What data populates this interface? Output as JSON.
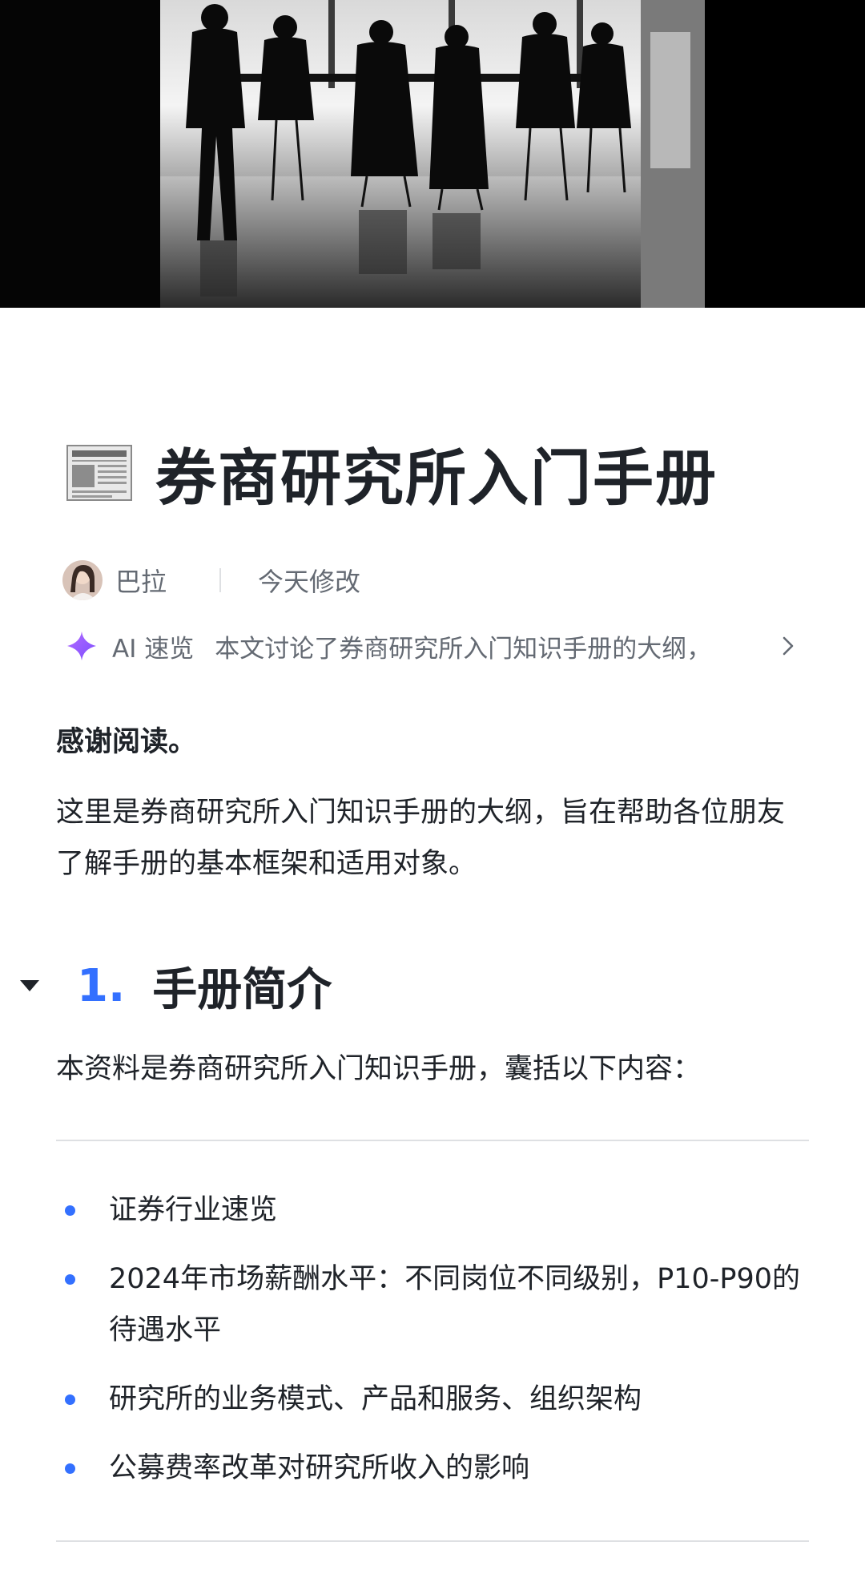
{
  "cover": {
    "alt": "meeting-silhouette-cover"
  },
  "document": {
    "title": "券商研究所入门手册",
    "author": "巴拉",
    "modified": "今天修改"
  },
  "ai_summary": {
    "label": "AI 速览",
    "text": "本文讨论了券商研究所入门知识手册的大纲，"
  },
  "content": {
    "thanks": "感谢阅读。",
    "intro": "这里是券商研究所入门知识手册的大纲，旨在帮助各位朋友了解手册的基本框架和适用对象。",
    "section_1": {
      "number": "1.",
      "title": "手册简介",
      "intro": "本资料是券商研究所入门知识手册，囊括以下内容："
    },
    "bullets": [
      "证券行业速览",
      "2024年市场薪酬水平：不同岗位不同级别，P10-P90的待遇水平",
      "研究所的业务模式、产品和服务、组织架构",
      "公募费率改革对研究所收入的影响"
    ]
  },
  "colors": {
    "accent": "#3370ff",
    "text": "#1f2329",
    "muted": "#646a73",
    "divider": "#dee0e3"
  },
  "icons": [
    "newspaper-icon",
    "avatar",
    "sparkle-icon",
    "chevron-right-icon",
    "collapse-triangle-icon"
  ]
}
